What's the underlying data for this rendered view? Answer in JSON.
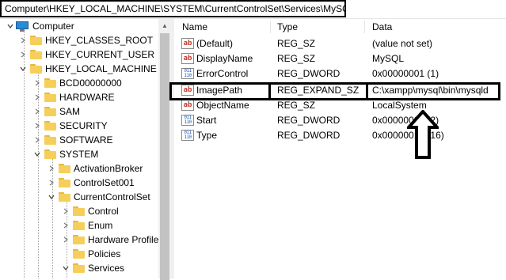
{
  "address_bar": {
    "path": "Computer\\HKEY_LOCAL_MACHINE\\SYSTEM\\CurrentControlSet\\Services\\MySQL"
  },
  "tree": {
    "root": "Computer",
    "items": [
      {
        "label": "HKEY_CLASSES_ROOT"
      },
      {
        "label": "HKEY_CURRENT_USER"
      },
      {
        "label": "HKEY_LOCAL_MACHINE"
      },
      {
        "label": "BCD00000000"
      },
      {
        "label": "HARDWARE"
      },
      {
        "label": "SAM"
      },
      {
        "label": "SECURITY"
      },
      {
        "label": "SOFTWARE"
      },
      {
        "label": "SYSTEM"
      },
      {
        "label": "ActivationBroker"
      },
      {
        "label": "ControlSet001"
      },
      {
        "label": "CurrentControlSet"
      },
      {
        "label": "Control"
      },
      {
        "label": "Enum"
      },
      {
        "label": "Hardware Profiles"
      },
      {
        "label": "Policies"
      },
      {
        "label": "Services"
      }
    ]
  },
  "list": {
    "columns": {
      "name": "Name",
      "type": "Type",
      "data": "Data"
    },
    "rows": [
      {
        "icon": "string-value-icon",
        "name": "(Default)",
        "type": "REG_SZ",
        "data": "(value not set)"
      },
      {
        "icon": "string-value-icon",
        "name": "DisplayName",
        "type": "REG_SZ",
        "data": "MySQL"
      },
      {
        "icon": "binary-value-icon",
        "name": "ErrorControl",
        "type": "REG_DWORD",
        "data": "0x00000001 (1)"
      },
      {
        "icon": "string-value-icon",
        "name": "ImagePath",
        "type": "REG_EXPAND_SZ",
        "data": "C:\\xampp\\mysql\\bin\\mysqld"
      },
      {
        "icon": "string-value-icon",
        "name": "ObjectName",
        "type": "REG_SZ",
        "data": "LocalSystem"
      },
      {
        "icon": "binary-value-icon",
        "name": "Start",
        "type": "REG_DWORD",
        "data": "0x00000002 (2)"
      },
      {
        "icon": "binary-value-icon",
        "name": "Type",
        "type": "REG_DWORD",
        "data": "0x00000010 (16)"
      }
    ]
  },
  "colors": {
    "highlight_border": "#000000",
    "folder": "#f6cf5b",
    "string_icon": "#c0392b",
    "binary_icon": "#2060b0"
  }
}
